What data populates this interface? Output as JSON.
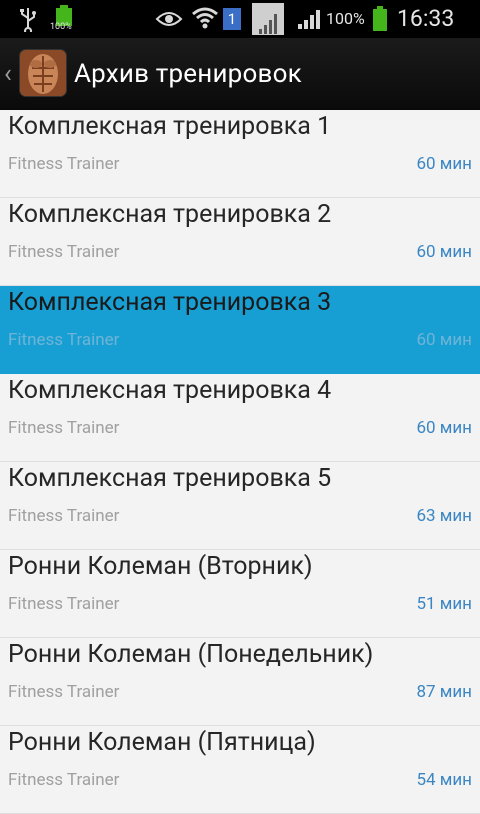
{
  "statusbar": {
    "left_battery_percent": "100%",
    "sim_badge": "1",
    "battery_percent": "100%",
    "time": "16:33",
    "icons": [
      "usb-icon",
      "battery-small-icon",
      "eye-icon",
      "wifi-icon",
      "sim-icon",
      "signal-box-icon",
      "signal-icon",
      "battery-icon"
    ]
  },
  "actionbar": {
    "title": "Архив тренировок"
  },
  "workouts": [
    {
      "name": "Комплексная тренировка 1",
      "subtitle": "Fitness Trainer",
      "duration": "60 мин",
      "selected": false
    },
    {
      "name": "Комплексная тренировка 2",
      "subtitle": "Fitness Trainer",
      "duration": "60 мин",
      "selected": false
    },
    {
      "name": "Комплексная тренировка 3",
      "subtitle": "Fitness Trainer",
      "duration": "60 мин",
      "selected": true
    },
    {
      "name": "Комплексная тренировка 4",
      "subtitle": "Fitness Trainer",
      "duration": "60 мин",
      "selected": false
    },
    {
      "name": "Комплексная тренировка 5",
      "subtitle": "Fitness Trainer",
      "duration": "63 мин",
      "selected": false
    },
    {
      "name": "Ронни Колеман (Вторник)",
      "subtitle": "Fitness Trainer",
      "duration": "51 мин",
      "selected": false
    },
    {
      "name": "Ронни Колеман (Понедельник)",
      "subtitle": "Fitness Trainer",
      "duration": "87 мин",
      "selected": false
    },
    {
      "name": "Ронни Колеман (Пятница)",
      "subtitle": "Fitness Trainer",
      "duration": "54 мин",
      "selected": false
    }
  ],
  "colors": {
    "selected_row": "#179fd3",
    "duration_text": "#3a86c4",
    "battery_green": "#44b51a"
  }
}
